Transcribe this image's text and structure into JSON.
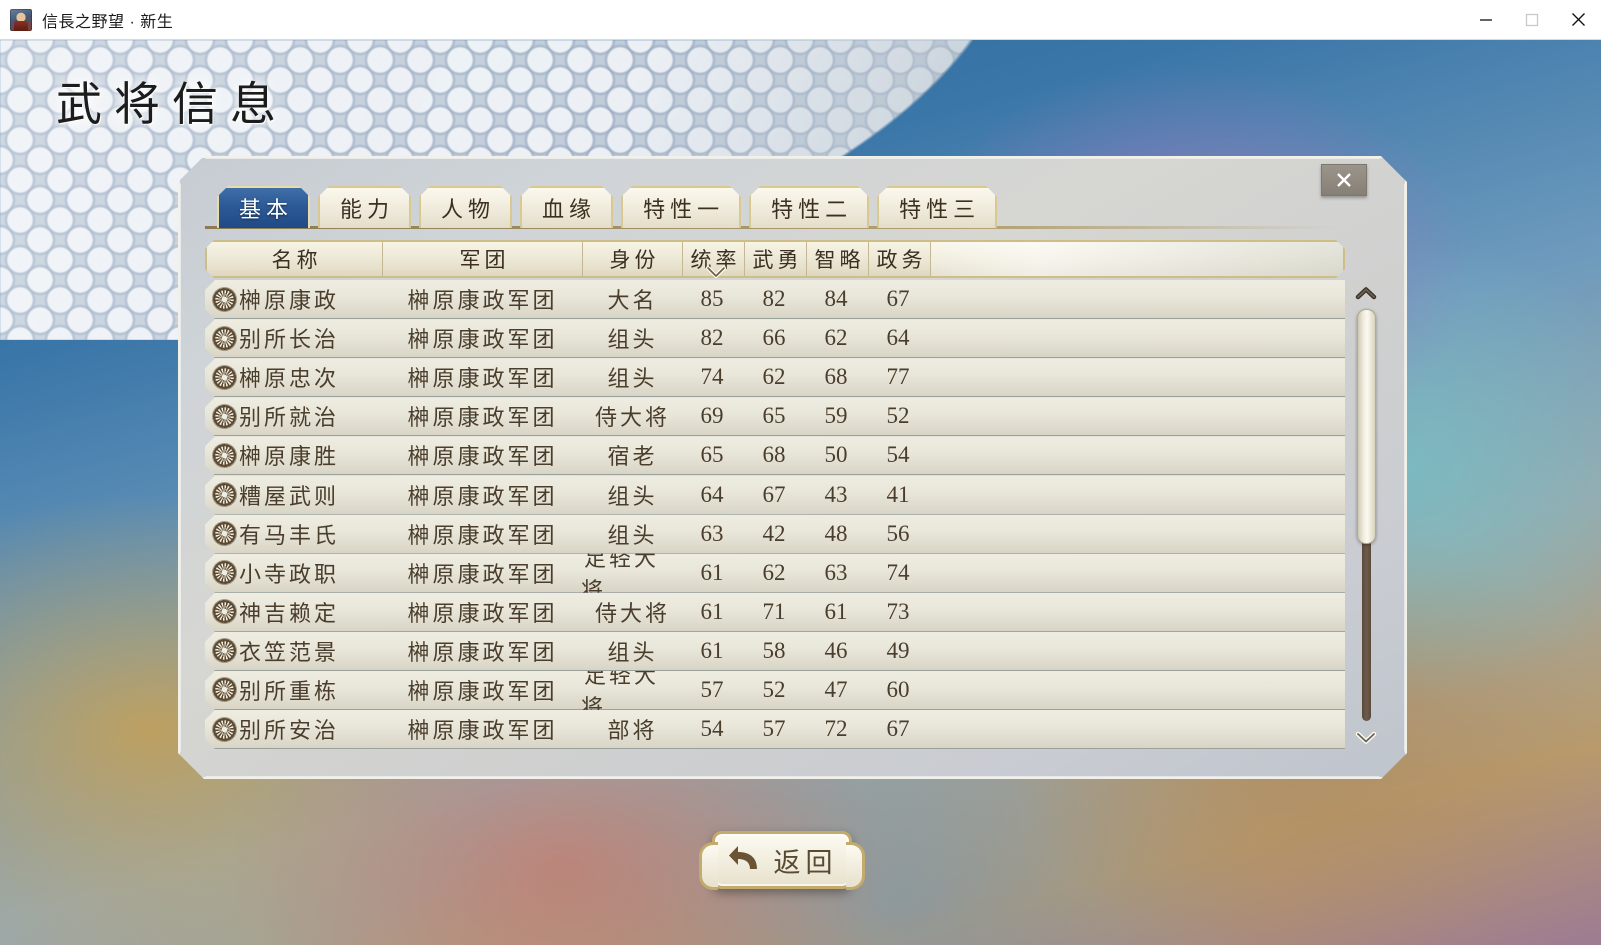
{
  "window": {
    "title": "信長之野望 · 新生",
    "app_icon": "warrior-portrait-icon",
    "minimize_label": "minimize-icon",
    "maximize_label": "maximize-icon",
    "close_label": "close-icon"
  },
  "banner": {
    "page_title": "武将信息"
  },
  "panel": {
    "close_label": "✕",
    "tabs": [
      {
        "label": "基本",
        "active": true
      },
      {
        "label": "能力",
        "active": false
      },
      {
        "label": "人物",
        "active": false
      },
      {
        "label": "血缘",
        "active": false
      },
      {
        "label": "特性一",
        "active": false
      },
      {
        "label": "特性二",
        "active": false
      },
      {
        "label": "特性三",
        "active": false
      }
    ],
    "columns": [
      {
        "label": "名称",
        "sorted": false
      },
      {
        "label": "军团",
        "sorted": false
      },
      {
        "label": "身份",
        "sorted": false
      },
      {
        "label": "统率",
        "sorted": true,
        "sort_direction": "desc"
      },
      {
        "label": "武勇",
        "sorted": false
      },
      {
        "label": "智略",
        "sorted": false
      },
      {
        "label": "政务",
        "sorted": false
      }
    ],
    "rows": [
      {
        "crest": "clan-crest-icon",
        "name": "榊原康政",
        "corps": "榊原康政军团",
        "status": "大名",
        "leadership": "85",
        "valor": "82",
        "intellect": "84",
        "politics": "67"
      },
      {
        "crest": "clan-crest-icon",
        "name": "别所长治",
        "corps": "榊原康政军团",
        "status": "组头",
        "leadership": "82",
        "valor": "66",
        "intellect": "62",
        "politics": "64"
      },
      {
        "crest": "clan-crest-icon",
        "name": "榊原忠次",
        "corps": "榊原康政军团",
        "status": "组头",
        "leadership": "74",
        "valor": "62",
        "intellect": "68",
        "politics": "77"
      },
      {
        "crest": "clan-crest-icon",
        "name": "别所就治",
        "corps": "榊原康政军团",
        "status": "侍大将",
        "leadership": "69",
        "valor": "65",
        "intellect": "59",
        "politics": "52"
      },
      {
        "crest": "clan-crest-icon",
        "name": "榊原康胜",
        "corps": "榊原康政军团",
        "status": "宿老",
        "leadership": "65",
        "valor": "68",
        "intellect": "50",
        "politics": "54"
      },
      {
        "crest": "clan-crest-icon",
        "name": "糟屋武则",
        "corps": "榊原康政军团",
        "status": "组头",
        "leadership": "64",
        "valor": "67",
        "intellect": "43",
        "politics": "41"
      },
      {
        "crest": "clan-crest-icon",
        "name": "有马丰氏",
        "corps": "榊原康政军团",
        "status": "组头",
        "leadership": "63",
        "valor": "42",
        "intellect": "48",
        "politics": "56"
      },
      {
        "crest": "clan-crest-icon",
        "name": "小寺政职",
        "corps": "榊原康政军团",
        "status": "足轻大将",
        "leadership": "61",
        "valor": "62",
        "intellect": "63",
        "politics": "74"
      },
      {
        "crest": "clan-crest-icon",
        "name": "神吉赖定",
        "corps": "榊原康政军团",
        "status": "侍大将",
        "leadership": "61",
        "valor": "71",
        "intellect": "61",
        "politics": "73"
      },
      {
        "crest": "clan-crest-icon",
        "name": "衣笠范景",
        "corps": "榊原康政军团",
        "status": "组头",
        "leadership": "61",
        "valor": "58",
        "intellect": "46",
        "politics": "49"
      },
      {
        "crest": "clan-crest-icon",
        "name": "别所重栋",
        "corps": "榊原康政军团",
        "status": "足轻大将",
        "leadership": "57",
        "valor": "52",
        "intellect": "47",
        "politics": "60"
      },
      {
        "crest": "clan-crest-icon",
        "name": "别所安治",
        "corps": "榊原康政军团",
        "status": "部将",
        "leadership": "54",
        "valor": "57",
        "intellect": "72",
        "politics": "67"
      }
    ],
    "scrollbar": {
      "up_icon": "chevron-up-icon",
      "down_icon": "chevron-down-icon",
      "thumb_position_percent": 0,
      "thumb_size_percent": 57
    }
  },
  "footer": {
    "back_label": "返回",
    "back_icon": "back-arrow-icon"
  },
  "colors": {
    "tab_active": "#2d5a96",
    "panel_border": "#f3f1e6",
    "row_text": "#4a3d2c",
    "gold_border": "#cdbd86"
  }
}
